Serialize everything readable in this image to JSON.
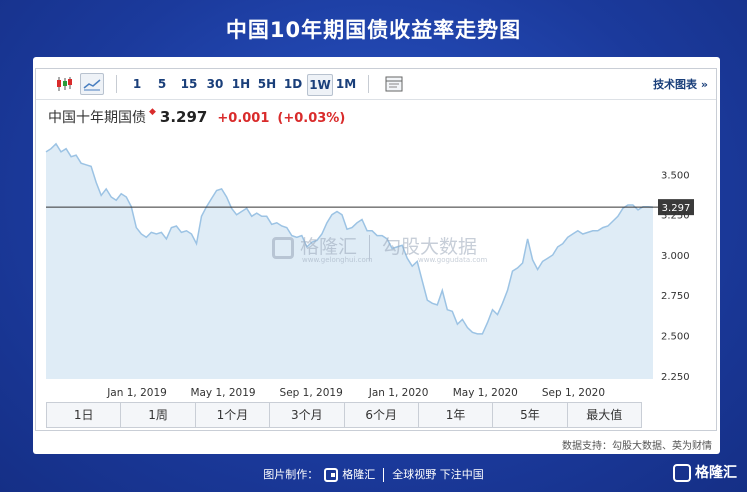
{
  "page_title": "中国10年期国债收益率走势图",
  "toolbar": {
    "periods": [
      "1",
      "5",
      "15",
      "30",
      "1H",
      "5H",
      "1D",
      "1W",
      "1M"
    ],
    "active_period": "1W",
    "tech_link": "技术图表 »"
  },
  "quote": {
    "name": "中国十年期国债",
    "price": "3.297",
    "change": "+0.001",
    "change_pct": "(+0.03%)"
  },
  "watermark": {
    "brand": "格隆汇",
    "brand_sub": "www.gelonghui.com",
    "partner": "勾股大数据",
    "partner_sub": "www.gogudata.com"
  },
  "range_buttons": [
    "1日",
    "1周",
    "1个月",
    "3个月",
    "6个月",
    "1年",
    "5年",
    "最大值"
  ],
  "source": "数据支持：勾股大数据、英为财情",
  "footer": {
    "made_by": "图片制作：",
    "brand": "格隆汇",
    "slogan": "全球视野 下注中国"
  },
  "corner_logo": "格隆汇",
  "colors": {
    "background": "#1c3fa8",
    "line": "#9cc3e4",
    "area": "#dfecf6",
    "price_up": "#d92b2b",
    "text_dark": "#1a3f7a"
  },
  "chart_data": {
    "type": "area",
    "title": "中国十年期国债",
    "y_ticks": [
      2.25,
      2.5,
      2.75,
      3.0,
      3.25,
      3.5
    ],
    "y_tick_labels": [
      "2.250",
      "2.500",
      "2.750",
      "3.000",
      "3.250",
      "3.500"
    ],
    "ylim": [
      2.23,
      3.72
    ],
    "x_ticks": [
      "2019-01-01",
      "2019-05-01",
      "2019-09-01",
      "2020-01-01",
      "2020-05-01",
      "2020-09-01"
    ],
    "x_tick_labels": [
      "Jan 1, 2019",
      "May 1, 2019",
      "Sep 1, 2019",
      "Jan 1, 2020",
      "May 1, 2020",
      "Sep 1, 2020"
    ],
    "xlim": [
      "2018-08-27",
      "2020-12-21"
    ],
    "current_value": 3.297,
    "current_label": "3.297",
    "grid": false,
    "series": [
      {
        "x": [
          "2018-08-27",
          "2018-09-03",
          "2018-09-10",
          "2018-09-17",
          "2018-09-24",
          "2018-10-01",
          "2018-10-08",
          "2018-10-15",
          "2018-10-22",
          "2018-10-29",
          "2018-11-05",
          "2018-11-12",
          "2018-11-19",
          "2018-11-26",
          "2018-12-03",
          "2018-12-10",
          "2018-12-17",
          "2018-12-24",
          "2018-12-31",
          "2019-01-07",
          "2019-01-14",
          "2019-01-21",
          "2019-01-28",
          "2019-02-04",
          "2019-02-11",
          "2019-02-18",
          "2019-02-25",
          "2019-03-04",
          "2019-03-11",
          "2019-03-18",
          "2019-03-25",
          "2019-04-01",
          "2019-04-08",
          "2019-04-15",
          "2019-04-22",
          "2019-04-29",
          "2019-05-06",
          "2019-05-13",
          "2019-05-20",
          "2019-05-27",
          "2019-06-03",
          "2019-06-10",
          "2019-06-17",
          "2019-06-24",
          "2019-07-01",
          "2019-07-08",
          "2019-07-15",
          "2019-07-22",
          "2019-07-29",
          "2019-08-05",
          "2019-08-12",
          "2019-08-19",
          "2019-08-26",
          "2019-09-02",
          "2019-09-09",
          "2019-09-16",
          "2019-09-23",
          "2019-09-30",
          "2019-10-07",
          "2019-10-14",
          "2019-10-21",
          "2019-10-28",
          "2019-11-04",
          "2019-11-11",
          "2019-11-18",
          "2019-11-25",
          "2019-12-02",
          "2019-12-09",
          "2019-12-16",
          "2019-12-23",
          "2019-12-30",
          "2020-01-06",
          "2020-01-13",
          "2020-01-20",
          "2020-01-27",
          "2020-02-03",
          "2020-02-10",
          "2020-02-17",
          "2020-02-24",
          "2020-03-02",
          "2020-03-09",
          "2020-03-16",
          "2020-03-23",
          "2020-03-30",
          "2020-04-06",
          "2020-04-13",
          "2020-04-20",
          "2020-04-27",
          "2020-05-04",
          "2020-05-11",
          "2020-05-18",
          "2020-05-25",
          "2020-06-01",
          "2020-06-08",
          "2020-06-15",
          "2020-06-22",
          "2020-06-29",
          "2020-07-06",
          "2020-07-13",
          "2020-07-20",
          "2020-07-27",
          "2020-08-03",
          "2020-08-10",
          "2020-08-17",
          "2020-08-24",
          "2020-08-31",
          "2020-09-07",
          "2020-09-14",
          "2020-09-21",
          "2020-09-28",
          "2020-10-05",
          "2020-10-12",
          "2020-10-19",
          "2020-10-26",
          "2020-11-02",
          "2020-11-09",
          "2020-11-16",
          "2020-11-23",
          "2020-11-30",
          "2020-12-07",
          "2020-12-14",
          "2020-12-21"
        ],
        "values": [
          3.64,
          3.66,
          3.69,
          3.64,
          3.66,
          3.61,
          3.62,
          3.57,
          3.56,
          3.55,
          3.45,
          3.37,
          3.41,
          3.36,
          3.34,
          3.38,
          3.36,
          3.3,
          3.17,
          3.13,
          3.11,
          3.14,
          3.13,
          3.14,
          3.1,
          3.17,
          3.18,
          3.14,
          3.15,
          3.13,
          3.07,
          3.24,
          3.3,
          3.35,
          3.4,
          3.41,
          3.36,
          3.29,
          3.25,
          3.27,
          3.29,
          3.24,
          3.26,
          3.24,
          3.24,
          3.19,
          3.2,
          3.18,
          3.17,
          3.12,
          3.11,
          3.12,
          3.05,
          3.08,
          3.09,
          3.13,
          3.2,
          3.25,
          3.27,
          3.25,
          3.16,
          3.17,
          3.2,
          3.22,
          3.15,
          3.15,
          3.12,
          3.12,
          3.1,
          3.04,
          3.05,
          3.06,
          2.98,
          2.93,
          2.96,
          2.84,
          2.72,
          2.7,
          2.69,
          2.78,
          2.66,
          2.65,
          2.57,
          2.6,
          2.55,
          2.52,
          2.51,
          2.51,
          2.58,
          2.66,
          2.63,
          2.7,
          2.78,
          2.9,
          2.92,
          2.95,
          3.1,
          2.97,
          2.91,
          2.96,
          2.98,
          3.0,
          3.05,
          3.07,
          3.11,
          3.13,
          3.15,
          3.13,
          3.14,
          3.15,
          3.15,
          3.17,
          3.18,
          3.21,
          3.24,
          3.29,
          3.31,
          3.31,
          3.28,
          3.3,
          3.3,
          3.297
        ]
      }
    ]
  }
}
